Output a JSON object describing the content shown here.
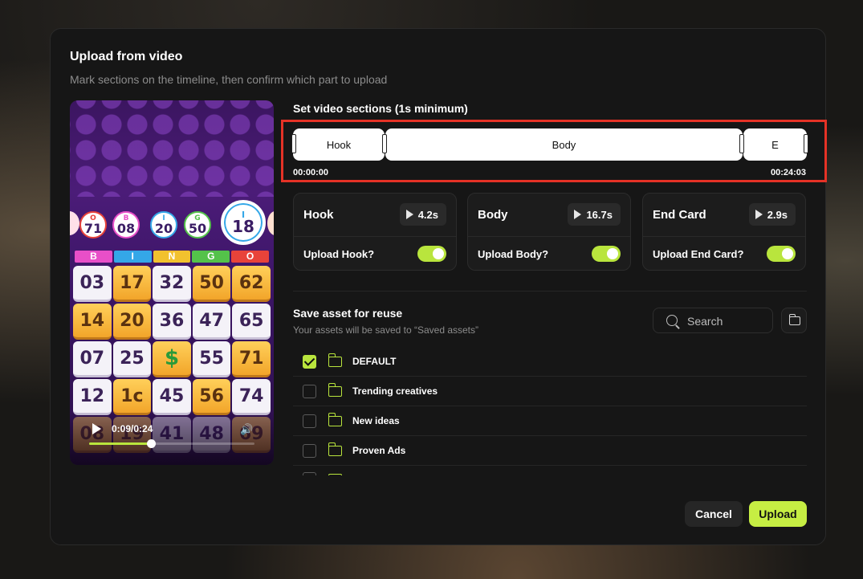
{
  "modal": {
    "title": "Upload from video",
    "subtitle": "Mark sections on the timeline, then confirm which part to upload"
  },
  "video": {
    "time_display": "0:09/0:24",
    "progress_fraction": 0.375,
    "balls": [
      {
        "letter": "O",
        "number": "71"
      },
      {
        "letter": "B",
        "number": "08"
      },
      {
        "letter": "I",
        "number": "20"
      },
      {
        "letter": "G",
        "number": "50"
      },
      {
        "letter": "I",
        "number": "18"
      }
    ],
    "bingo_letters": [
      "B",
      "I",
      "N",
      "G",
      "O"
    ],
    "bingo_letter_colors": [
      "#e84fc8",
      "#34a7e8",
      "#f2c12e",
      "#54c24a",
      "#e8433a"
    ],
    "grid": [
      "03",
      "17",
      "32",
      "50",
      "62",
      "14",
      "20",
      "36",
      "47",
      "65",
      "07",
      "25",
      "$",
      "55",
      "71",
      "12",
      "1c",
      "45",
      "56",
      "74",
      "08",
      "19",
      "41",
      "48",
      "69"
    ]
  },
  "timeline": {
    "title": "Set video sections (1s minimum)",
    "segments": [
      {
        "label": "Hook"
      },
      {
        "label": "Body"
      },
      {
        "label": "E"
      }
    ],
    "start_time": "00:00:00",
    "end_time": "00:24:03"
  },
  "sections": [
    {
      "name": "Hook",
      "duration": "4.2s",
      "upload_label": "Upload Hook?",
      "enabled": true
    },
    {
      "name": "Body",
      "duration": "16.7s",
      "upload_label": "Upload Body?",
      "enabled": true
    },
    {
      "name": "End Card",
      "duration": "2.9s",
      "upload_label": "Upload End Card?",
      "enabled": true
    }
  ],
  "save_asset": {
    "title": "Save asset for reuse",
    "subtitle": "Your assets will be saved to “Saved assets”",
    "search_placeholder": "Search",
    "folders": [
      {
        "name": "DEFAULT",
        "checked": true
      },
      {
        "name": "Trending creatives",
        "checked": false
      },
      {
        "name": "New ideas",
        "checked": false
      },
      {
        "name": "Proven Ads",
        "checked": false
      }
    ]
  },
  "actions": {
    "cancel_label": "Cancel",
    "upload_label": "Upload"
  },
  "colors": {
    "accent": "#c6ee43",
    "highlight_border": "#e53226"
  }
}
